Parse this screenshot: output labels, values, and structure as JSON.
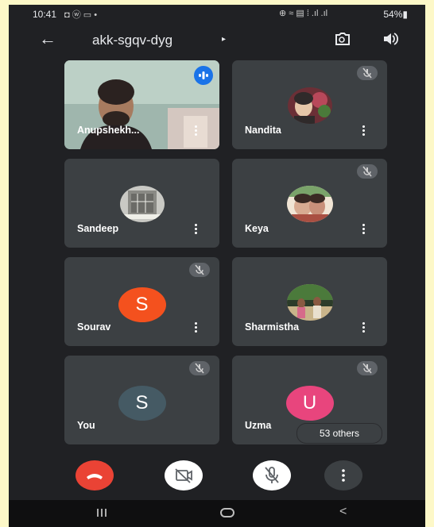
{
  "status_bar": {
    "time": "10:41",
    "left_icons": "◘ ⓦ ▭ •",
    "right_icons": "⊕ ≈ ▤ ⁞ .ıl .ıl",
    "battery": "54%▮"
  },
  "top_bar": {
    "meeting_code": "akk-sgqv-dyg",
    "caret": "▸"
  },
  "participants": [
    {
      "name": "Anupshekh...",
      "kind": "video",
      "speaking": true
    },
    {
      "name": "Nandita",
      "kind": "photo",
      "muted": true,
      "photo_colors": [
        "#9c3a4a",
        "#e6c7a9",
        "#2f2a2a"
      ]
    },
    {
      "name": "Sandeep",
      "kind": "photo",
      "muted": false,
      "photo_colors": [
        "#c9c9c4",
        "#6b6b67",
        "#efefe8"
      ]
    },
    {
      "name": "Keya",
      "kind": "photo",
      "muted": true,
      "photo_colors": [
        "#d8ab92",
        "#a94f42",
        "#f1e5d5"
      ]
    },
    {
      "name": "Sourav",
      "kind": "letter",
      "letter": "S",
      "avatar_color": "#f4511e",
      "muted": true
    },
    {
      "name": "Sharmistha",
      "kind": "photo",
      "muted": false,
      "photo_colors": [
        "#4b7a3b",
        "#c9b48a",
        "#2c3c2a"
      ]
    },
    {
      "name": "You",
      "kind": "letter",
      "letter": "S",
      "avatar_color": "#455a64",
      "muted": true
    },
    {
      "name": "Uzma",
      "kind": "letter",
      "letter": "U",
      "avatar_color": "#e8457d",
      "muted": true
    }
  ],
  "others_count_label": "53 others",
  "controls": {
    "end_color": "#ea4335",
    "camera": "camera-off",
    "mic": "mic-off"
  },
  "colors": {
    "background": "#202124",
    "tile": "#3c4043",
    "speaking_badge": "#1a73e8"
  }
}
